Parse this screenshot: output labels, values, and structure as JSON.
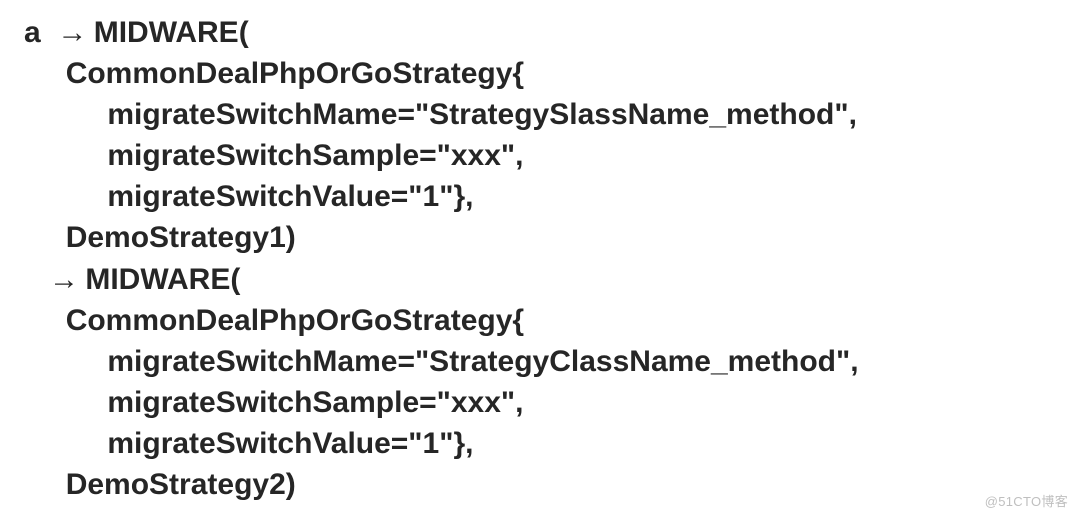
{
  "code": {
    "var": "a",
    "arrow": "→",
    "block1": {
      "keyword": "MIDWARE(",
      "struct": "CommonDealPhpOrGoStrategy{",
      "l1": "migrateSwitchMame=\"StrategySlassName_method\",",
      "l2": "migrateSwitchSample=\"xxx\",",
      "l3": "migrateSwitchValue=\"1\"},",
      "closing": "DemoStrategy1)"
    },
    "block2": {
      "keyword": "MIDWARE(",
      "struct": "CommonDealPhpOrGoStrategy{",
      "l1": "migrateSwitchMame=\"StrategyClassName_method\",",
      "l2": "migrateSwitchSample=\"xxx\",",
      "l3": "migrateSwitchValue=\"1\"},",
      "closing": "DemoStrategy2)"
    }
  },
  "watermark": "@51CTO博客"
}
